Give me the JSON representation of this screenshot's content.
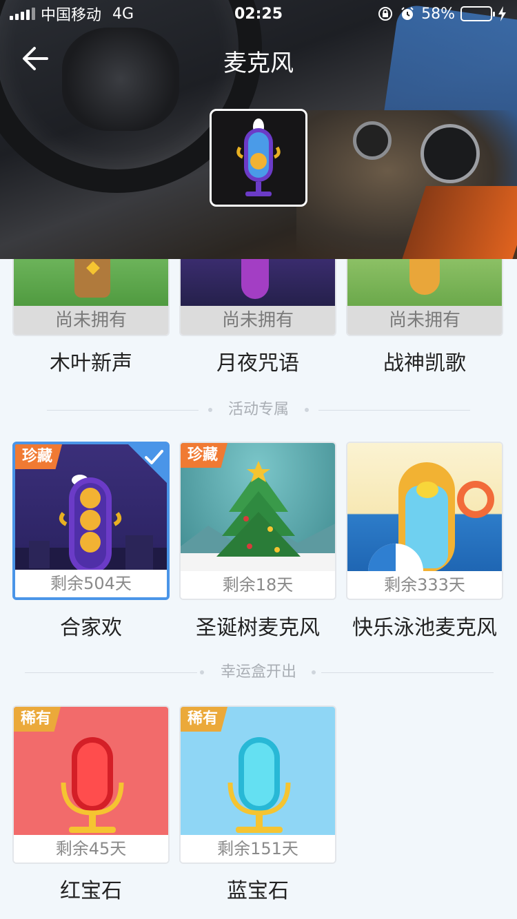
{
  "status_bar": {
    "carrier": "中国移动",
    "network": "4G",
    "time": "02:25",
    "battery": "58%",
    "battery_level": 0.58
  },
  "header": {
    "title": "麦克风",
    "back_icon": "arrow-left-icon"
  },
  "owned_section": {
    "items": [
      {
        "name": "木叶新声",
        "status": "尚未拥有"
      },
      {
        "name": "月夜咒语",
        "status": "尚未拥有"
      },
      {
        "name": "战神凯歌",
        "status": "尚未拥有"
      }
    ]
  },
  "event_section": {
    "title": "活动专属",
    "items": [
      {
        "name": "合家欢",
        "remaining": "剩余504天",
        "badge": "珍藏",
        "selected": true
      },
      {
        "name": "圣诞树麦克风",
        "remaining": "剩余18天",
        "badge": "珍藏"
      },
      {
        "name": "快乐泳池麦克风",
        "remaining": "剩余333天"
      }
    ]
  },
  "lucky_box_section": {
    "title": "幸运盒开出",
    "items": [
      {
        "name": "红宝石",
        "remaining": "剩余45天",
        "badge": "稀有"
      },
      {
        "name": "蓝宝石",
        "remaining": "剩余151天",
        "badge": "稀有"
      }
    ]
  },
  "colors": {
    "accent": "#4a95e8",
    "badge_treasure": "#f07a33",
    "badge_rare": "#eba93a",
    "background": "#f2f7fb"
  }
}
